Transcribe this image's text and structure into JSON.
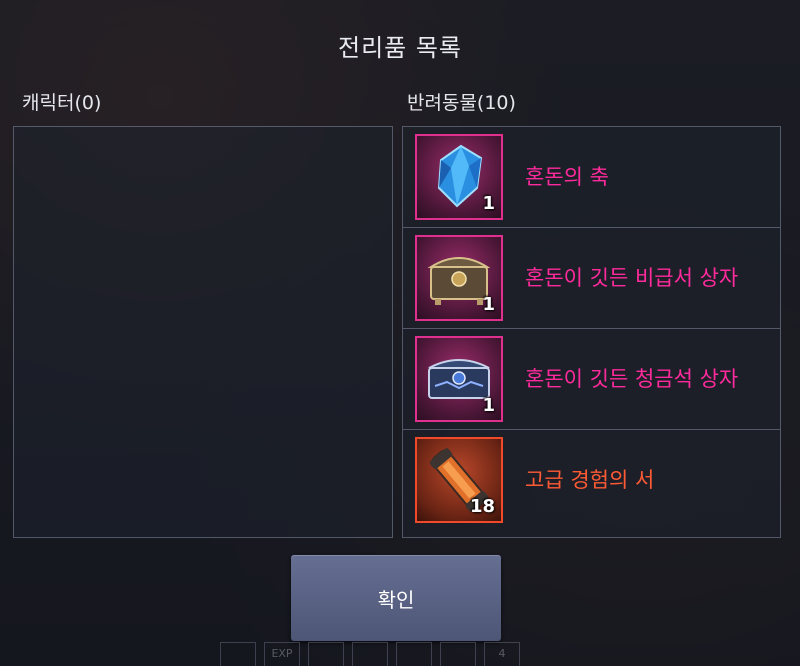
{
  "dialog": {
    "title": "전리품 목록",
    "confirm_label": "확인"
  },
  "character_section": {
    "label": "캐릭터(0)",
    "items": []
  },
  "pet_section": {
    "label": "반려동물(10)",
    "items": [
      {
        "name": "혼돈의 축",
        "quantity": "1",
        "icon": "blue-crystal-icon",
        "rarity_color": "#ff2a9c"
      },
      {
        "name": "혼돈이 깃든 비급서 상자",
        "quantity": "1",
        "icon": "ornate-gold-chest-icon",
        "rarity_color": "#ff2a9c"
      },
      {
        "name": "혼돈이 깃든 청금석 상자",
        "quantity": "1",
        "icon": "ornate-blue-chest-icon",
        "rarity_color": "#ff2a9c"
      },
      {
        "name": "고급 경험의 서",
        "quantity": "18",
        "icon": "scroll-icon",
        "rarity_color": "#ff5a34"
      }
    ]
  },
  "bottom_bar": {
    "exp_label": "EXP",
    "badge_count": "4"
  }
}
